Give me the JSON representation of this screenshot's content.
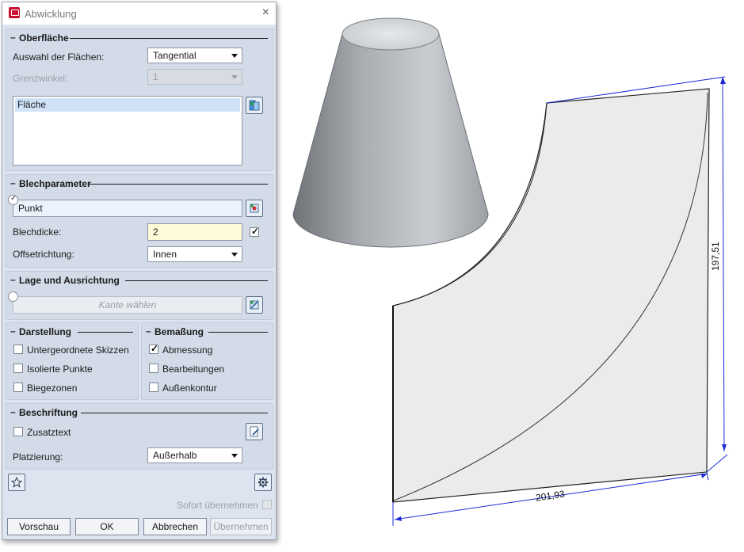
{
  "dialog": {
    "title": "Abwicklung",
    "close_glyph": "×",
    "sections": {
      "oberflaeche": {
        "title": "Oberfläche",
        "auswahl_label": "Auswahl der Flächen:",
        "auswahl_value": "Tangential",
        "grenzwinkel_label": "Grenzwinkel:",
        "grenzwinkel_value": "1",
        "list_item": "Fläche"
      },
      "blechparameter": {
        "title": "Blechparameter",
        "punkt_value": "Punkt",
        "blechdicke_label": "Blechdicke:",
        "blechdicke_value": "2",
        "blechdicke_checked": true,
        "offset_label": "Offsetrichtung:",
        "offset_value": "Innen"
      },
      "lage": {
        "title": "Lage und Ausrichtung",
        "kante_placeholder": "Kante wählen"
      },
      "darstellung": {
        "title": "Darstellung",
        "items": [
          {
            "label": "Untergeordnete Skizzen",
            "checked": false
          },
          {
            "label": "Isolierte Punkte",
            "checked": false
          },
          {
            "label": "Biegezonen",
            "checked": false
          }
        ]
      },
      "bemassung": {
        "title": "Bemaßung",
        "items": [
          {
            "label": "Abmessung",
            "checked": true
          },
          {
            "label": "Bearbeitungen",
            "checked": false
          },
          {
            "label": "Außenkontur",
            "checked": false
          }
        ]
      },
      "beschriftung": {
        "title": "Beschriftung",
        "zusatztext_label": "Zusatztext",
        "zusatztext_checked": false,
        "platzierung_label": "Platzierung:",
        "platzierung_value": "Außerhalb"
      }
    },
    "sofort_label": "Sofort übernehmen",
    "buttons": {
      "vorschau": "Vorschau",
      "ok": "OK",
      "abbrechen": "Abbrechen",
      "uebernehmen": "Übernehmen"
    },
    "icons": {
      "favorite": "star-icon",
      "settings": "gear-icon"
    }
  },
  "viewport": {
    "dimension_width": "201,93",
    "dimension_height": "197,51",
    "dimension_color": "#1e2bd6"
  }
}
